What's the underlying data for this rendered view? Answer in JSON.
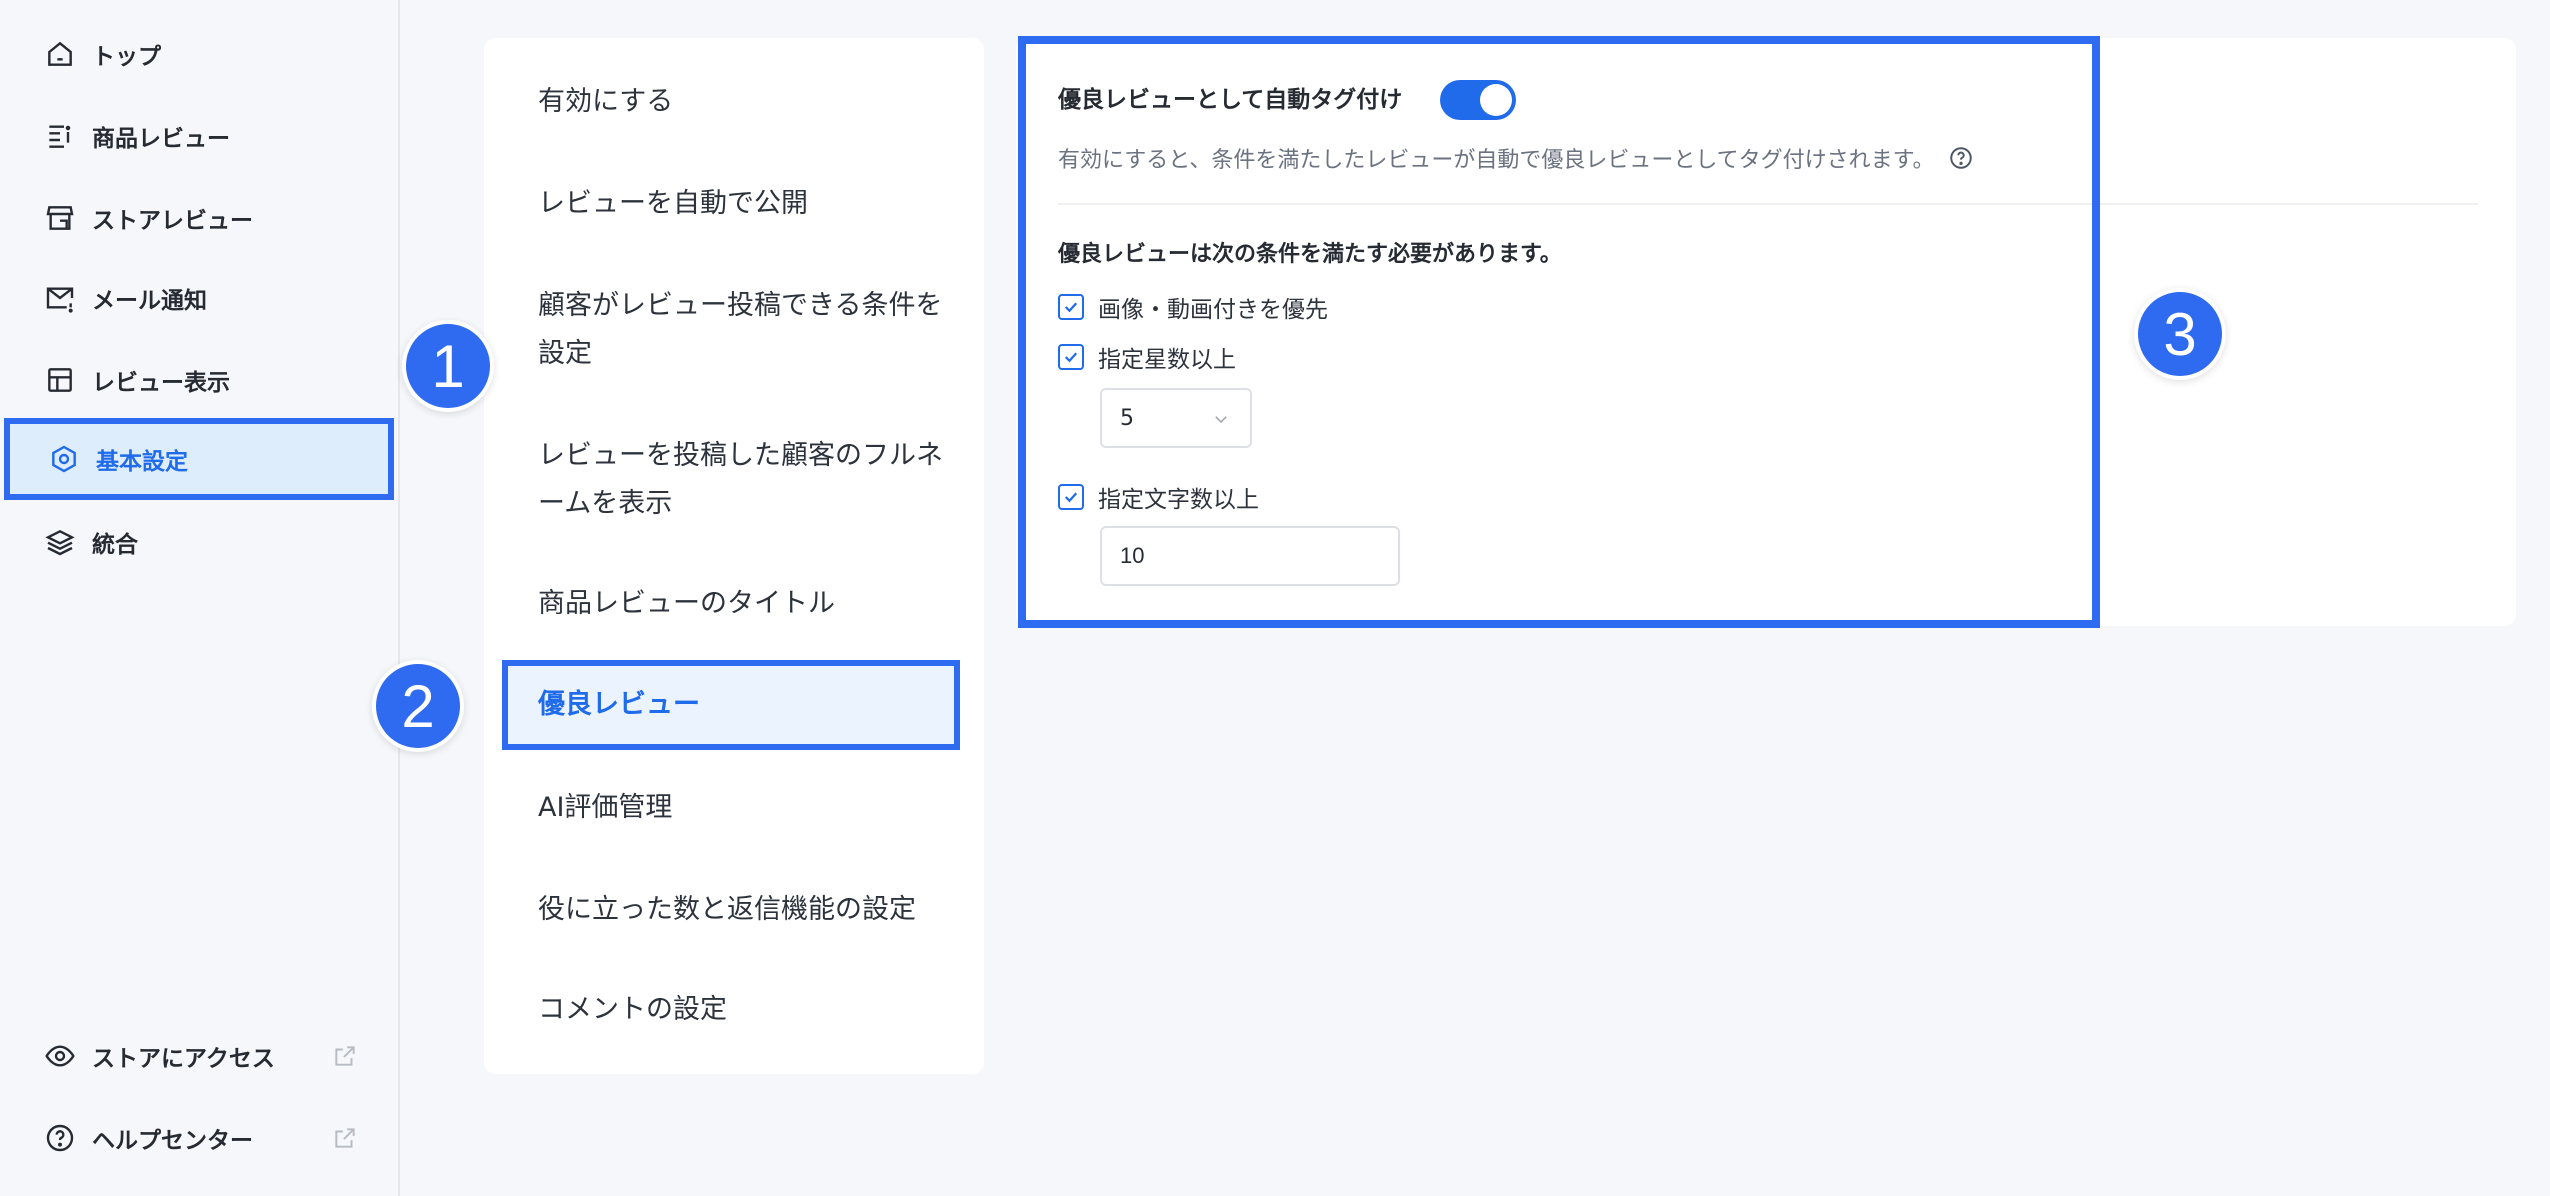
{
  "sidebar": {
    "items": [
      {
        "label": "トップ",
        "icon": "home-icon"
      },
      {
        "label": "商品レビュー",
        "icon": "review-list-icon"
      },
      {
        "label": "ストアレビュー",
        "icon": "store-icon"
      },
      {
        "label": "メール通知",
        "icon": "mail-icon"
      },
      {
        "label": "レビュー表示",
        "icon": "layout-icon"
      },
      {
        "label": "基本設定",
        "icon": "settings-icon"
      },
      {
        "label": "統合",
        "icon": "layers-icon"
      }
    ],
    "active_index": 5,
    "footer": [
      {
        "label": "ストアにアクセス",
        "icon": "eye-icon"
      },
      {
        "label": "ヘルプセンター",
        "icon": "help-circle-icon"
      }
    ]
  },
  "menu": {
    "items": [
      "有効にする",
      "レビューを自動で公開",
      "顧客がレビュー投稿できる条件を設定",
      "レビューを投稿した顧客のフルネームを表示",
      "商品レビューのタイトル",
      "優良レビュー",
      "AI評価管理",
      "役に立った数と返信機能の設定",
      "コメントの設定"
    ],
    "active_index": 5
  },
  "badges": [
    "1",
    "2",
    "3"
  ],
  "settings": {
    "title": "優良レビューとして自動タグ付け",
    "toggle_on": true,
    "description": "有効にすると、条件を満たしたレビューが自動で優良レビューとしてタグ付けされます。",
    "conditions_title": "優良レビューは次の条件を満たす必要があります。",
    "conditions": [
      {
        "label": "画像・動画付きを優先",
        "checked": true
      },
      {
        "label": "指定星数以上",
        "checked": true
      },
      {
        "label": "指定文字数以上",
        "checked": true
      }
    ],
    "min_stars": "5",
    "min_chars": "10"
  },
  "colors": {
    "accent": "#1f6bea",
    "highlight": "#2f6bf0",
    "active_bg": "#deedfc"
  }
}
